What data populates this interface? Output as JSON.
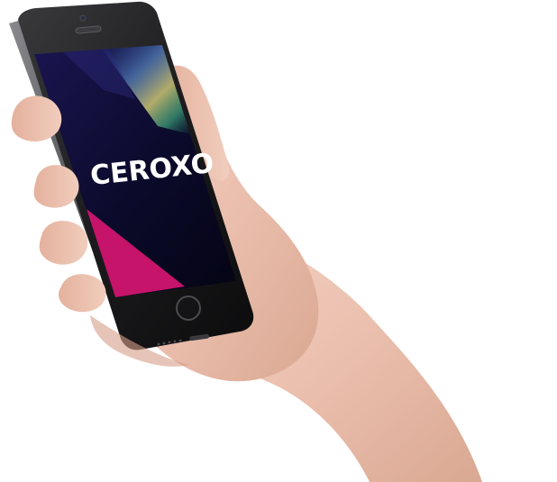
{
  "screen": {
    "brand_name": "CEROXO",
    "brand_color": "#ffffff",
    "accent_color": "#c5146a",
    "background_color": "#0b0a2a"
  },
  "device": {
    "body_color": "#1b1b1d",
    "home_button_icon": "home-button-icon",
    "speaker_icon": "earpiece-speaker-icon",
    "camera_icon": "front-camera-icon"
  }
}
